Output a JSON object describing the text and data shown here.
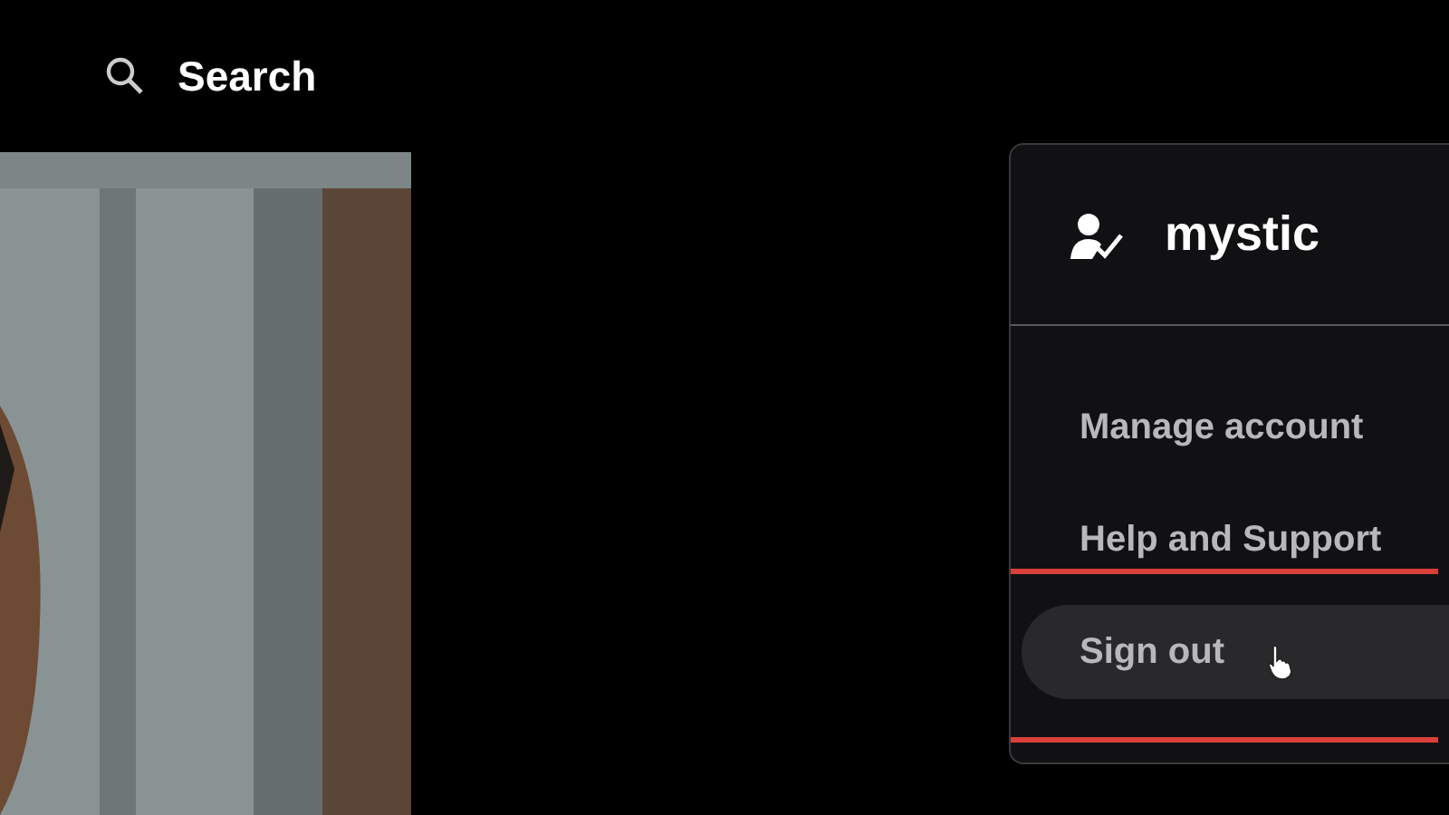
{
  "top_bar": {
    "search": {
      "label": "Search"
    }
  },
  "account_menu": {
    "username": "mystic",
    "items": [
      {
        "label": "Manage account",
        "hovered": false,
        "outlined": false,
        "cursor": false
      },
      {
        "label": "Help and Support",
        "hovered": false,
        "outlined": false,
        "cursor": false
      },
      {
        "label": "Sign out",
        "hovered": true,
        "outlined": true,
        "cursor": true
      }
    ]
  }
}
